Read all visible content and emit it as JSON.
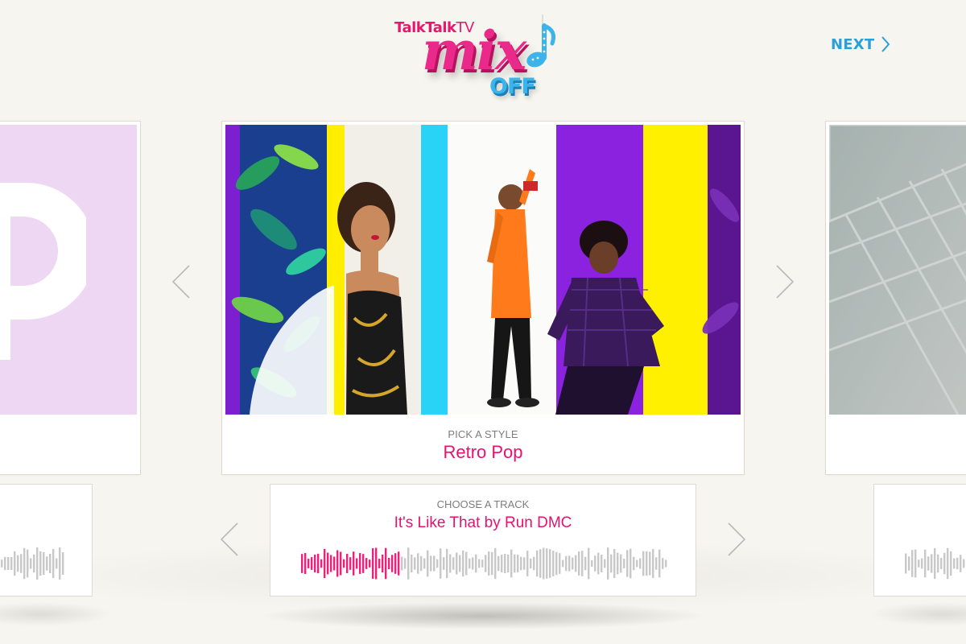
{
  "header": {
    "brand": "TalkTalk",
    "brand_tv": "TV",
    "logo_word_1": "mix",
    "logo_word_2": "OFF",
    "next_label": "NEXT"
  },
  "style_picker": {
    "label": "PICK A STYLE",
    "selected_style": "Retro Pop"
  },
  "track_picker": {
    "label": "CHOOSE A TRACK",
    "selected_track": "It's Like That by Run DMC",
    "playback_progress": 0.27
  },
  "colors": {
    "accent_pink": "#e3136f",
    "accent_blue": "#2a9fd8",
    "waveform_played": "#e8237e",
    "waveform_unplayed": "#c8c8c8",
    "arrow_gray": "#b9b9b9"
  },
  "icons": {
    "next": "chevron-right-icon",
    "prev_style": "chevron-left-icon",
    "next_style": "chevron-right-icon",
    "prev_track": "chevron-left-icon",
    "next_track": "chevron-right-icon",
    "logo_note": "music-note-icon"
  }
}
